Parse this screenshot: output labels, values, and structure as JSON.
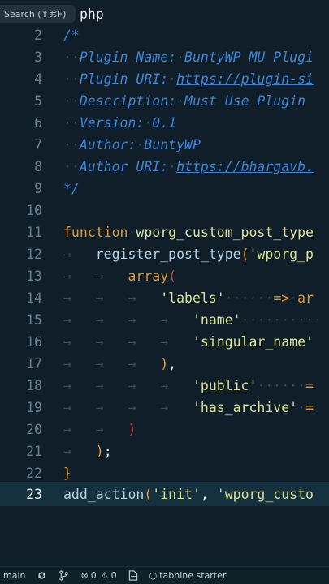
{
  "title_bar": {
    "search_label": "Search (⇧⌘F)",
    "file_text": "php"
  },
  "editor": {
    "lines": [
      {
        "n": "2"
      },
      {
        "n": "3"
      },
      {
        "n": "4"
      },
      {
        "n": "5"
      },
      {
        "n": "6"
      },
      {
        "n": "7"
      },
      {
        "n": "8"
      },
      {
        "n": "9"
      },
      {
        "n": "10"
      },
      {
        "n": "11"
      },
      {
        "n": "12"
      },
      {
        "n": "13"
      },
      {
        "n": "14"
      },
      {
        "n": "15"
      },
      {
        "n": "16"
      },
      {
        "n": "17"
      },
      {
        "n": "18"
      },
      {
        "n": "19"
      },
      {
        "n": "20"
      },
      {
        "n": "21"
      },
      {
        "n": "22"
      },
      {
        "n": "23"
      }
    ],
    "text": {
      "l2": "/*",
      "l3_key": "Plugin Name:",
      "l3_val": "BuntyWP MU Plugi",
      "l4_key": "Plugin URI:",
      "l4_val": "https://plugin-si",
      "l5_key": "Description:",
      "l5_val": "Must Use Plugin",
      "l6_key": "Version:",
      "l6_val": "0.1",
      "l7_key": "Author:",
      "l7_val": "BuntyWP",
      "l8_key": "Author URI:",
      "l8_val": "https://bhargavb.",
      "l9": "*/",
      "l11_kw": "function",
      "l11_fn": "wporg_custom_post_type",
      "l12_fn": "register_post_type",
      "l12_str": "'wporg_p",
      "l13_kw": "array",
      "l14_str": "'labels'",
      "l14_tail": "ar",
      "l15_str": "'name'",
      "l16_str": "'singular_name'",
      "l18_str": "'public'",
      "l19_str": "'has_archive'",
      "l23_fn": "add_action",
      "l23_str1": "'init'",
      "l23_str2": "'wporg_custo"
    }
  },
  "status_bar": {
    "branch": "main",
    "errors": "0",
    "warnings": "0",
    "tabnine": "tabnine starter"
  },
  "colors": {
    "background": "#0f1e28",
    "comment": "#3a86d8",
    "keyword": "#e39a2a",
    "string": "#d7e39a"
  }
}
